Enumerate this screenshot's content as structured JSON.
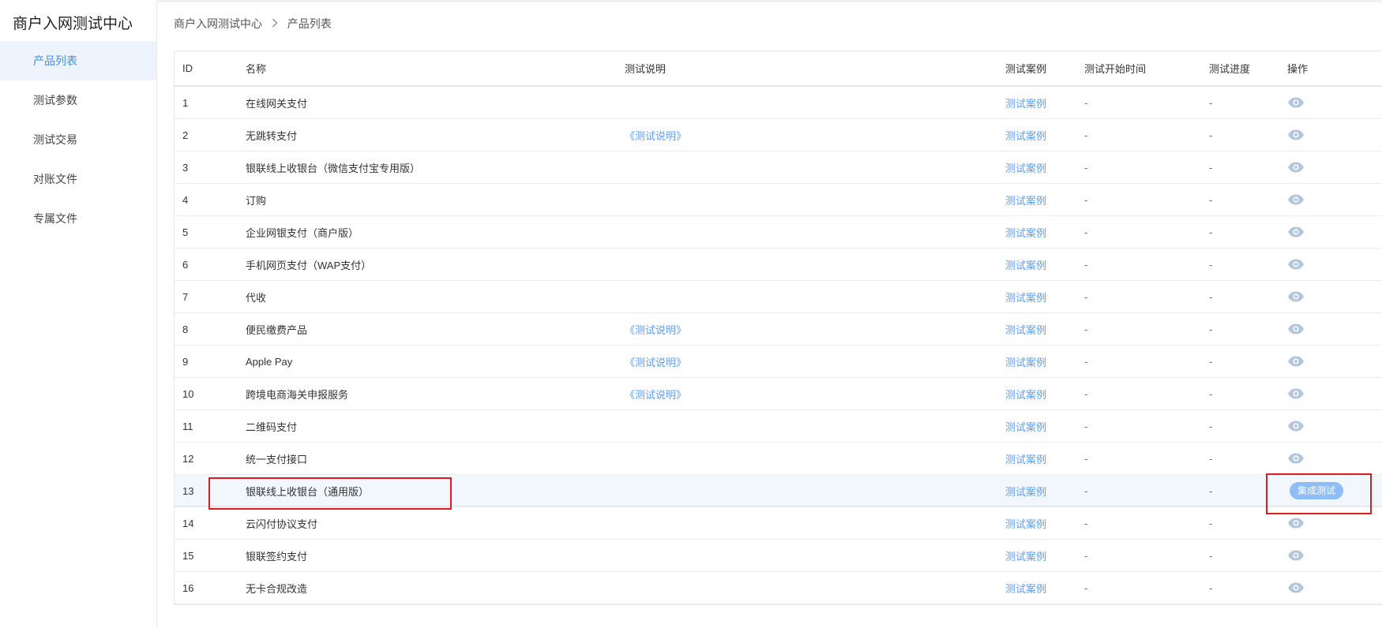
{
  "app": {
    "title": "商户入网测试中心"
  },
  "sidebar": {
    "items": [
      {
        "label": "产品列表",
        "active": true
      },
      {
        "label": "测试参数",
        "active": false
      },
      {
        "label": "测试交易",
        "active": false
      },
      {
        "label": "对账文件",
        "active": false
      },
      {
        "label": "专属文件",
        "active": false
      }
    ]
  },
  "breadcrumb": {
    "root": "商户入网测试中心",
    "current": "产品列表",
    "separator_icon": "chevron-right-icon"
  },
  "table": {
    "columns": [
      "ID",
      "名称",
      "测试说明",
      "测试案例",
      "测试开始时间",
      "测试进度",
      "操作"
    ],
    "rows": [
      {
        "id": "1",
        "name": "在线网关支付",
        "desc": "",
        "case": "测试案例",
        "start": "-",
        "progress": "-",
        "op": "view"
      },
      {
        "id": "2",
        "name": "无跳转支付",
        "desc": "《测试说明》",
        "case": "测试案例",
        "start": "-",
        "progress": "-",
        "op": "view"
      },
      {
        "id": "3",
        "name": "银联线上收银台（微信支付宝专用版）",
        "desc": "",
        "case": "测试案例",
        "start": "-",
        "progress": "-",
        "op": "view"
      },
      {
        "id": "4",
        "name": "订购",
        "desc": "",
        "case": "测试案例",
        "start": "-",
        "progress": "-",
        "op": "view"
      },
      {
        "id": "5",
        "name": "企业网银支付（商户版）",
        "desc": "",
        "case": "测试案例",
        "start": "-",
        "progress": "-",
        "op": "view"
      },
      {
        "id": "6",
        "name": "手机网页支付（WAP支付）",
        "desc": "",
        "case": "测试案例",
        "start": "-",
        "progress": "-",
        "op": "view"
      },
      {
        "id": "7",
        "name": "代收",
        "desc": "",
        "case": "测试案例",
        "start": "-",
        "progress": "-",
        "op": "view"
      },
      {
        "id": "8",
        "name": "便民缴费产品",
        "desc": "《测试说明》",
        "case": "测试案例",
        "start": "-",
        "progress": "-",
        "op": "view"
      },
      {
        "id": "9",
        "name": "Apple Pay",
        "desc": "《测试说明》",
        "case": "测试案例",
        "start": "-",
        "progress": "-",
        "op": "view"
      },
      {
        "id": "10",
        "name": "跨境电商海关申报服务",
        "desc": "《测试说明》",
        "case": "测试案例",
        "start": "-",
        "progress": "-",
        "op": "view"
      },
      {
        "id": "11",
        "name": "二维码支付",
        "desc": "",
        "case": "测试案例",
        "start": "-",
        "progress": "-",
        "op": "view"
      },
      {
        "id": "12",
        "name": "统一支付接口",
        "desc": "",
        "case": "测试案例",
        "start": "-",
        "progress": "-",
        "op": "view"
      },
      {
        "id": "13",
        "name": "银联线上收银台（通用版）",
        "desc": "",
        "case": "测试案例",
        "start": "-",
        "progress": "-",
        "op": "button",
        "op_label": "集成测试",
        "highlighted": true
      },
      {
        "id": "14",
        "name": "云闪付协议支付",
        "desc": "",
        "case": "测试案例",
        "start": "-",
        "progress": "-",
        "op": "view"
      },
      {
        "id": "15",
        "name": "银联签约支付",
        "desc": "",
        "case": "测试案例",
        "start": "-",
        "progress": "-",
        "op": "view"
      },
      {
        "id": "16",
        "name": "无卡合规改造",
        "desc": "",
        "case": "测试案例",
        "start": "-",
        "progress": "-",
        "op": "view"
      }
    ]
  },
  "colors": {
    "accent": "#3f8cf0",
    "link": "#5b9ef5",
    "eye_icon": "#b3c6dd",
    "highlight_row": "#f2f7fe",
    "annotation": "#e01b1b"
  }
}
